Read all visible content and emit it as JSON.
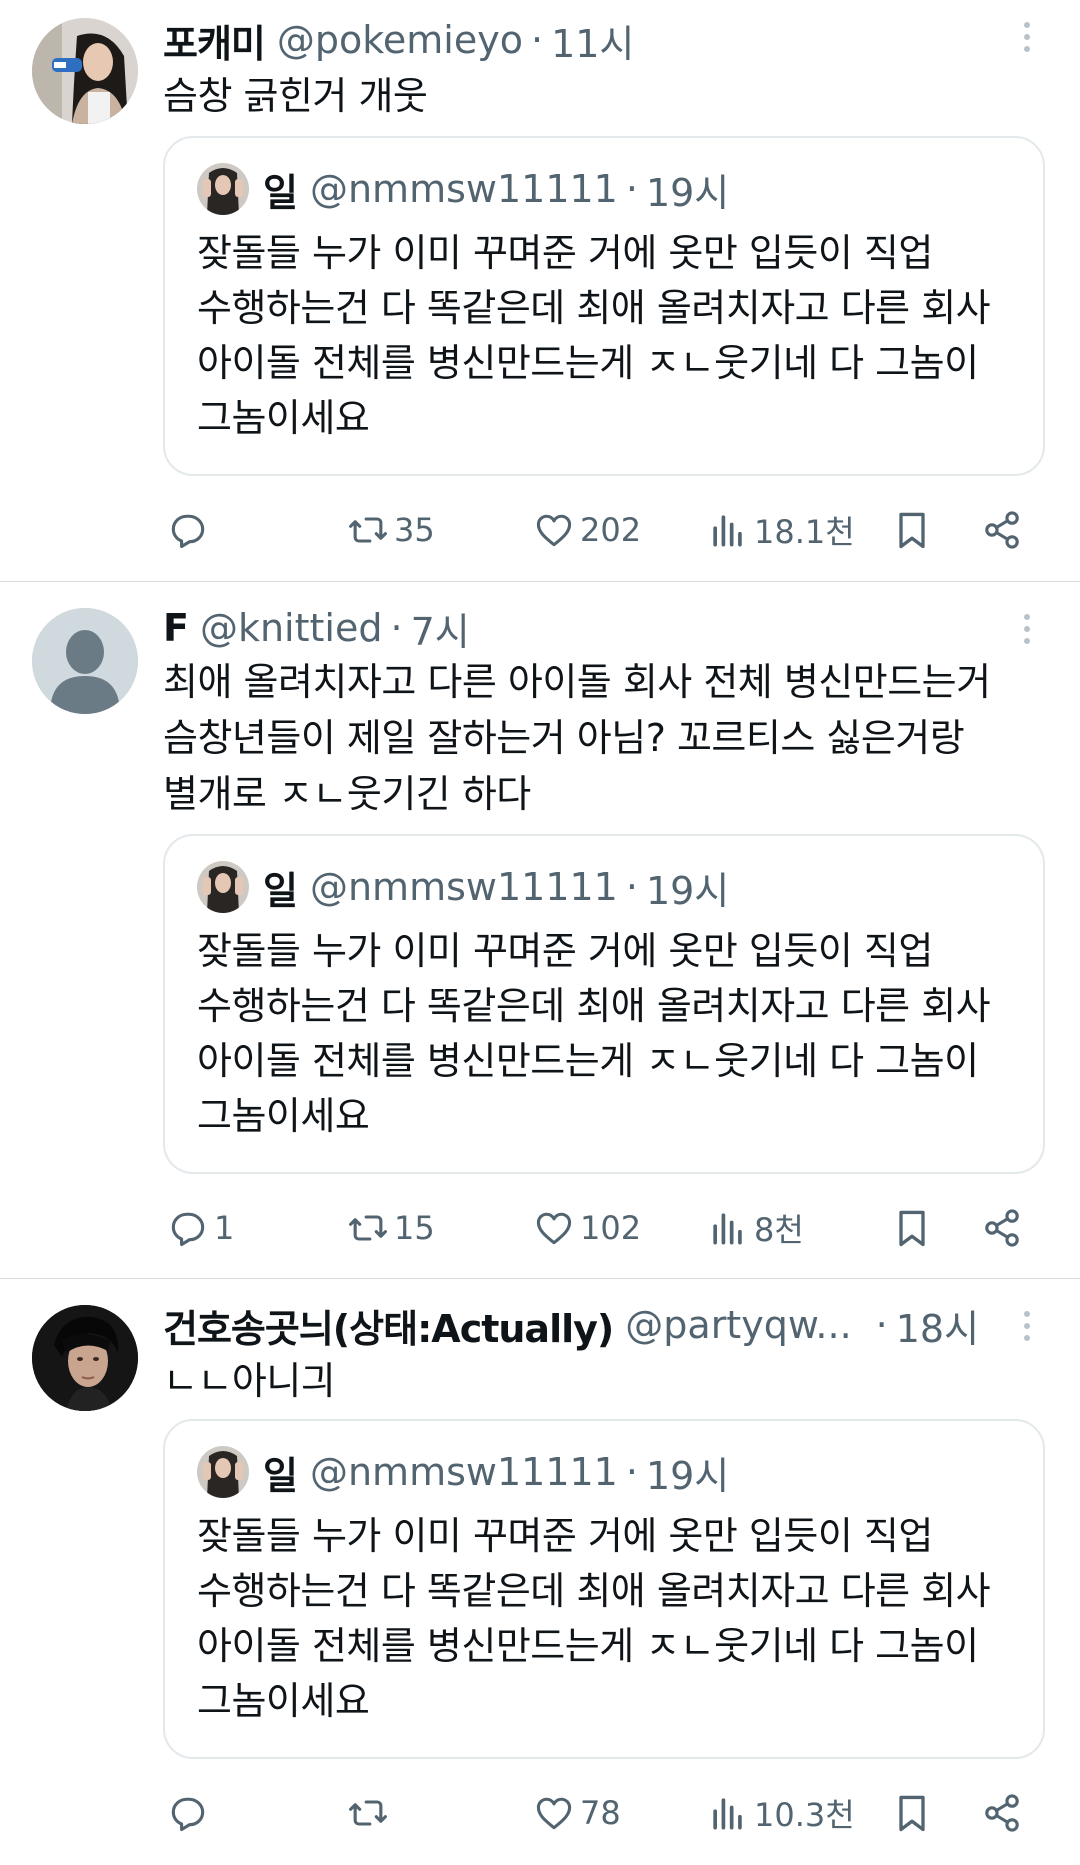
{
  "tweets": [
    {
      "name": "포캐미",
      "handle": "@pokemieyo",
      "time": "11시",
      "text": "슴창 긁힌거 개웃",
      "quote": {
        "name": "일",
        "handle": "@nmmsw11111",
        "time": "19시",
        "text": "잦돌들 누가 이미 꾸며준 거에 옷만 입듯이 직업\n수행하는건 다 똑같은데 최애 올려치자고 다른 회사\n아이돌 전체를 병신만드는게 ㅈㄴ웃기네 다 그놈이\n그놈이세요"
      },
      "stats": {
        "replies": "",
        "retweets": "35",
        "likes": "202",
        "views": "18.1천"
      }
    },
    {
      "name": "F",
      "handle": "@knittied",
      "time": "7시",
      "text": "최애 올려치자고 다른 아이돌 회사 전체 병신만드는거\n슴창년들이 제일 잘하는거 아님? 꼬르티스 싫은거랑\n별개로 ㅈㄴ웃기긴 하다",
      "quote": {
        "name": "일",
        "handle": "@nmmsw11111",
        "time": "19시",
        "text": "잦돌들 누가 이미 꾸며준 거에 옷만 입듯이 직업\n수행하는건 다 똑같은데 최애 올려치자고 다른 회사\n아이돌 전체를 병신만드는게 ㅈㄴ웃기네 다 그놈이\n그놈이세요"
      },
      "stats": {
        "replies": "1",
        "retweets": "15",
        "likes": "102",
        "views": "8천"
      }
    },
    {
      "name": "건호송곳늬(상태:Actually)",
      "handle": "@partyqw...",
      "time": "18시",
      "text": "ㄴㄴ아니긔",
      "quote": {
        "name": "일",
        "handle": "@nmmsw11111",
        "time": "19시",
        "text": "잦돌들 누가 이미 꾸며준 거에 옷만 입듯이 직업\n수행하는건 다 똑같은데 최애 올려치자고 다른 회사\n아이돌 전체를 병신만드는게 ㅈㄴ웃기네 다 그놈이\n그놈이세요"
      },
      "stats": {
        "replies": "",
        "retweets": "",
        "likes": "78",
        "views": "10.3천"
      }
    }
  ],
  "ui": {
    "separator": "·",
    "icons": [
      "reply-icon",
      "retweet-icon",
      "like-icon",
      "views-icon",
      "bookmark-icon",
      "share-icon",
      "more-icon",
      "default-avatar-icon"
    ],
    "colors": {
      "text": "#0f1419",
      "secondary": "#536471",
      "border": "#e3e8eb",
      "divider": "#d6dbde"
    }
  }
}
